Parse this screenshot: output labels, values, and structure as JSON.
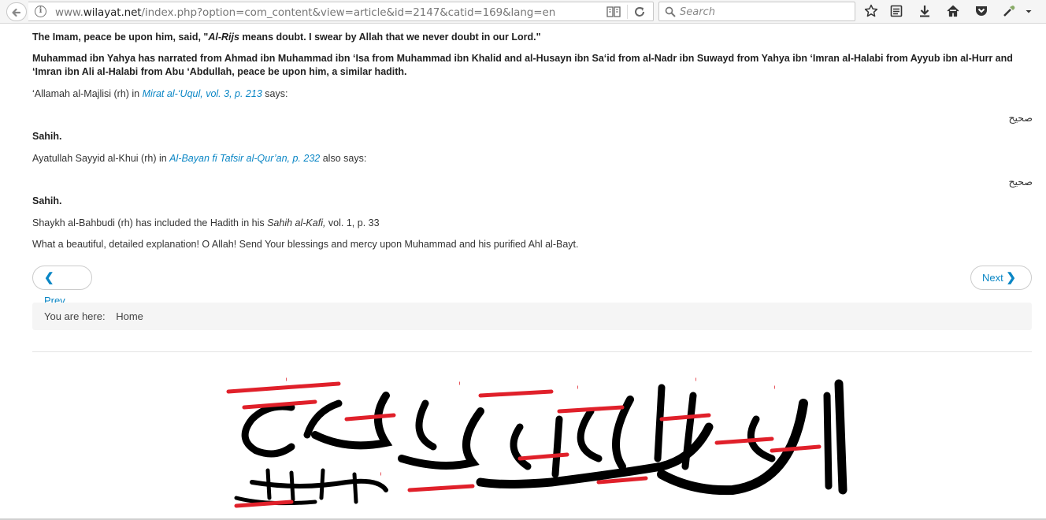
{
  "browser": {
    "url_prefix": "www.",
    "url_domain": "wilayat.net",
    "url_path": "/index.php?option=com_content&view=article&id=2147&catid=169&lang=en",
    "search_placeholder": "Search",
    "icons": [
      "back-arrow-icon",
      "info-icon",
      "reader-view-icon",
      "reload-icon",
      "search-icon",
      "bookmark-star-icon",
      "reading-list-icon",
      "download-icon",
      "home-icon",
      "pocket-icon",
      "eyedropper-icon",
      "menu-chevron-icon"
    ]
  },
  "article": {
    "p1_pre": "The Imam, peace be upon him, said, \"",
    "p1_em": "Al-Rijs",
    "p1_post": " means doubt. I swear by Allah that we never doubt in our Lord.\"",
    "p2": "Muhammad ibn Yahya has narrated from Ahmad ibn Muhammad ibn ‘Isa from Muhammad ibn Khalid and al-Husayn ibn Sa‘id from al-Nadr ibn Suwayd from Yahya ibn ‘Imran al-Halabi from Ayyub ibn al-Hurr and ‘Imran ibn Ali al-Halabi from Abu ‘Abdullah, peace be upon him, a similar hadith.",
    "p3_pre": "‘Allamah al-Majlisi (rh) in ",
    "p3_link": "Mirat al-‘Uqul, vol. 3, p. 213",
    "p3_post": " says:",
    "arabic1": "صحيح",
    "sahih1": "Sahih.",
    "p5_pre": "Ayatullah Sayyid al-Khui (rh) in ",
    "p5_link": "Al-Bayan fi Tafsir al-Qur’an, p. 232",
    "p5_post": " also says:",
    "arabic2": "صحيح",
    "sahih2": "Sahih.",
    "p7_pre": "Shaykh al-Bahbudi (rh) has included the Hadith in his ",
    "p7_em": "Sahih al-Kafi,",
    "p7_post": " vol. 1, p. 33",
    "p8": "What a beautiful, detailed explanation! O Allah! Send Your blessings and mercy upon Muhammad and his purified Ahl al-Bayt."
  },
  "pager": {
    "prev_label": "Prev",
    "next_label": "Next"
  },
  "breadcrumb": {
    "prefix": "You are here:",
    "home": "Home"
  },
  "banner": {
    "calligraphy_text": "اللهم صل على محمد وآل محمد وعجل فرجهم والعن أعدائهم أجمعين",
    "colors": {
      "ink": "#000000",
      "accent": "#e0202a"
    }
  }
}
